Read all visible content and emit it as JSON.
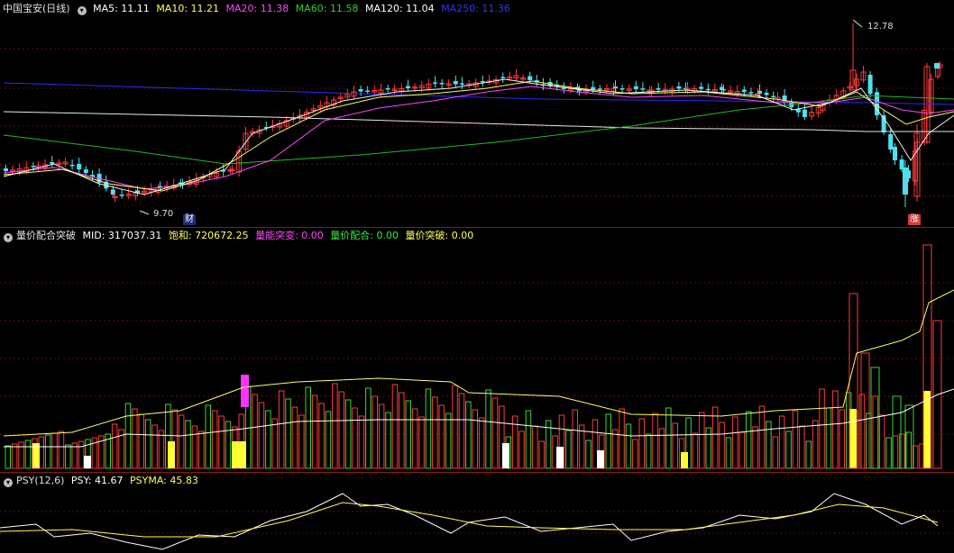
{
  "main": {
    "title": "中国宝安(日线)",
    "ma": [
      {
        "label": "MA5: 11.11",
        "color": "#ffffff"
      },
      {
        "label": "MA10: 11.21",
        "color": "#ffff55"
      },
      {
        "label": "MA20: 11.38",
        "color": "#ff44ff"
      },
      {
        "label": "MA60: 11.58",
        "color": "#33cc33"
      },
      {
        "label": "MA120: 11.04",
        "color": "#ffffff"
      },
      {
        "label": "MA250: 11.36",
        "color": "#3333ff"
      }
    ],
    "high_label": "12.78",
    "low_label": "9.70",
    "cai_tag": "财",
    "zhang_tag": "涨"
  },
  "vol": {
    "title": "量价配合突破",
    "items": [
      {
        "label": "MID: 317037.31",
        "color": "#ffffff"
      },
      {
        "label": "饱和: 720672.25",
        "color": "#ffff55"
      },
      {
        "label": "量能突变: 0.00",
        "color": "#ff44ff"
      },
      {
        "label": "量价配合: 0.00",
        "color": "#33ee33"
      },
      {
        "label": "量价突破: 0.00",
        "color": "#ffff55"
      }
    ]
  },
  "psy": {
    "title": "PSY(12,6)",
    "items": [
      {
        "label": "PSY: 41.67",
        "color": "#ffffff"
      },
      {
        "label": "PSYMA: 45.83",
        "color": "#ffff55"
      }
    ]
  }
}
